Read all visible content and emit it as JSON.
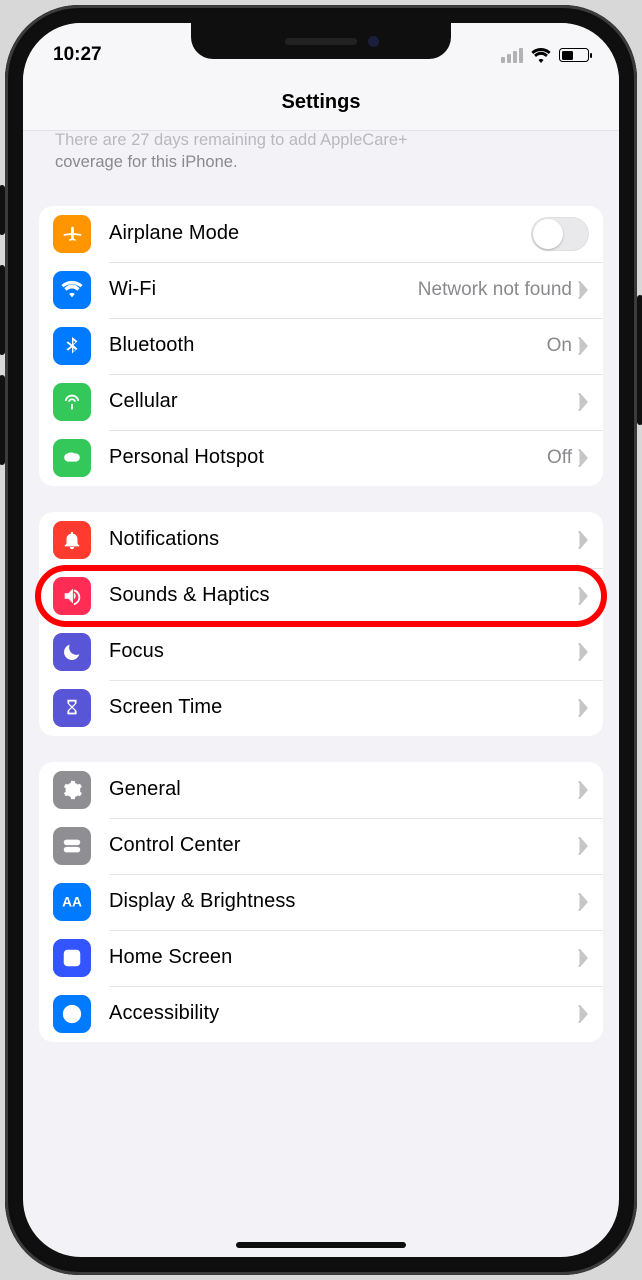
{
  "status": {
    "time": "10:27"
  },
  "navbar": {
    "title": "Settings"
  },
  "applecare_note": {
    "line1_cut": "There are 27 days remaining to add AppleCare+",
    "line2": "coverage for this iPhone."
  },
  "groups": [
    {
      "rows": [
        {
          "id": "airplane",
          "label": "Airplane Mode",
          "icon": "airplane-icon",
          "color": "#ff9500",
          "accessory": "toggle",
          "toggle_on": false
        },
        {
          "id": "wifi",
          "label": "Wi-Fi",
          "icon": "wifi-icon",
          "color": "#007aff",
          "accessory": "value-chevron",
          "value": "Network not found"
        },
        {
          "id": "bluetooth",
          "label": "Bluetooth",
          "icon": "bluetooth-icon",
          "color": "#007aff",
          "accessory": "value-chevron",
          "value": "On"
        },
        {
          "id": "cellular",
          "label": "Cellular",
          "icon": "cellular-icon",
          "color": "#34c759",
          "accessory": "chevron"
        },
        {
          "id": "hotspot",
          "label": "Personal Hotspot",
          "icon": "hotspot-icon",
          "color": "#34c759",
          "accessory": "value-chevron",
          "value": "Off"
        }
      ]
    },
    {
      "rows": [
        {
          "id": "notifications",
          "label": "Notifications",
          "icon": "bell-icon",
          "color": "#ff3b30",
          "accessory": "chevron"
        },
        {
          "id": "sounds",
          "label": "Sounds & Haptics",
          "icon": "speaker-icon",
          "color": "#ff2d55",
          "accessory": "chevron",
          "highlight": true
        },
        {
          "id": "focus",
          "label": "Focus",
          "icon": "moon-icon",
          "color": "#5856d6",
          "accessory": "chevron"
        },
        {
          "id": "screentime",
          "label": "Screen Time",
          "icon": "hourglass-icon",
          "color": "#5856d6",
          "accessory": "chevron"
        }
      ]
    },
    {
      "rows": [
        {
          "id": "general",
          "label": "General",
          "icon": "gear-icon",
          "color": "#8e8e93",
          "accessory": "chevron"
        },
        {
          "id": "controlcenter",
          "label": "Control Center",
          "icon": "switches-icon",
          "color": "#8e8e93",
          "accessory": "chevron"
        },
        {
          "id": "display",
          "label": "Display & Brightness",
          "icon": "aa-icon",
          "color": "#007aff",
          "accessory": "chevron"
        },
        {
          "id": "homescreen",
          "label": "Home Screen",
          "icon": "grid-icon",
          "color": "#3355ff",
          "accessory": "chevron"
        },
        {
          "id": "accessibility",
          "label": "Accessibility",
          "icon": "accessibility-icon",
          "color": "#007aff",
          "accessory": "chevron"
        }
      ]
    }
  ]
}
